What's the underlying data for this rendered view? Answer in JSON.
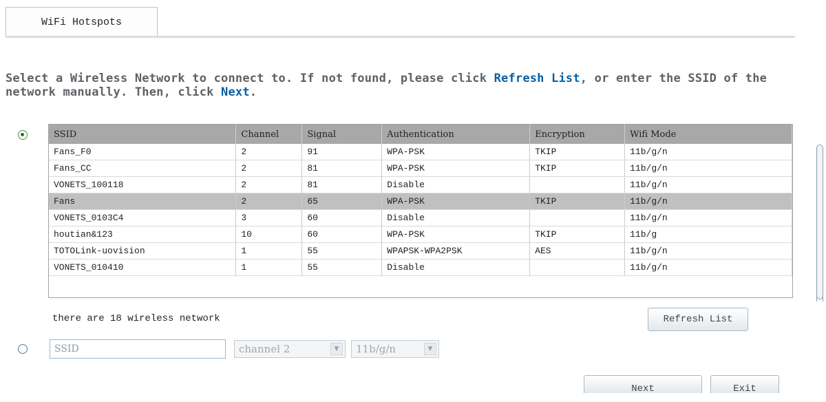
{
  "tab": {
    "label": "WiFi Hotspots"
  },
  "instructions": {
    "part1": "Select a Wireless Network to connect to. If not found, please click ",
    "refresh_link": "Refresh List",
    "part2": ", or enter the SSID of the network manually. Then, click ",
    "next_link": "Next",
    "part3": "."
  },
  "table": {
    "columns": [
      "SSID",
      "Channel",
      "Signal",
      "Authentication",
      "Encryption",
      "Wifi Mode"
    ],
    "rows": [
      {
        "ssid": "Fans_F0",
        "channel": "2",
        "signal": "91",
        "auth": "WPA-PSK",
        "enc": "TKIP",
        "mode": "11b/g/n"
      },
      {
        "ssid": "Fans_CC",
        "channel": "2",
        "signal": "81",
        "auth": "WPA-PSK",
        "enc": "TKIP",
        "mode": "11b/g/n"
      },
      {
        "ssid": "VONETS_100118",
        "channel": "2",
        "signal": "81",
        "auth": "Disable",
        "enc": "",
        "mode": "11b/g/n"
      },
      {
        "ssid": "Fans",
        "channel": "2",
        "signal": "65",
        "auth": "WPA-PSK",
        "enc": "TKIP",
        "mode": "11b/g/n"
      },
      {
        "ssid": "VONETS_0103C4",
        "channel": "3",
        "signal": "60",
        "auth": "Disable",
        "enc": "",
        "mode": "11b/g/n"
      },
      {
        "ssid": "houtian&123",
        "channel": "10",
        "signal": "60",
        "auth": "WPA-PSK",
        "enc": "TKIP",
        "mode": "11b/g"
      },
      {
        "ssid": "TOTOLink-uovision",
        "channel": "1",
        "signal": "55",
        "auth": "WPAPSK-WPA2PSK",
        "enc": "AES",
        "mode": "11b/g/n"
      },
      {
        "ssid": "VONETS_010410",
        "channel": "1",
        "signal": "55",
        "auth": "Disable",
        "enc": "",
        "mode": "11b/g/n"
      }
    ],
    "selected_row": 3
  },
  "network_count": "there are 18 wireless network",
  "buttons": {
    "refresh": "Refresh List",
    "next": "Next",
    "exit": "Exit"
  },
  "manual": {
    "ssid_placeholder": "SSID",
    "channel_value": "channel 2",
    "mode_value": "11b/g/n"
  }
}
